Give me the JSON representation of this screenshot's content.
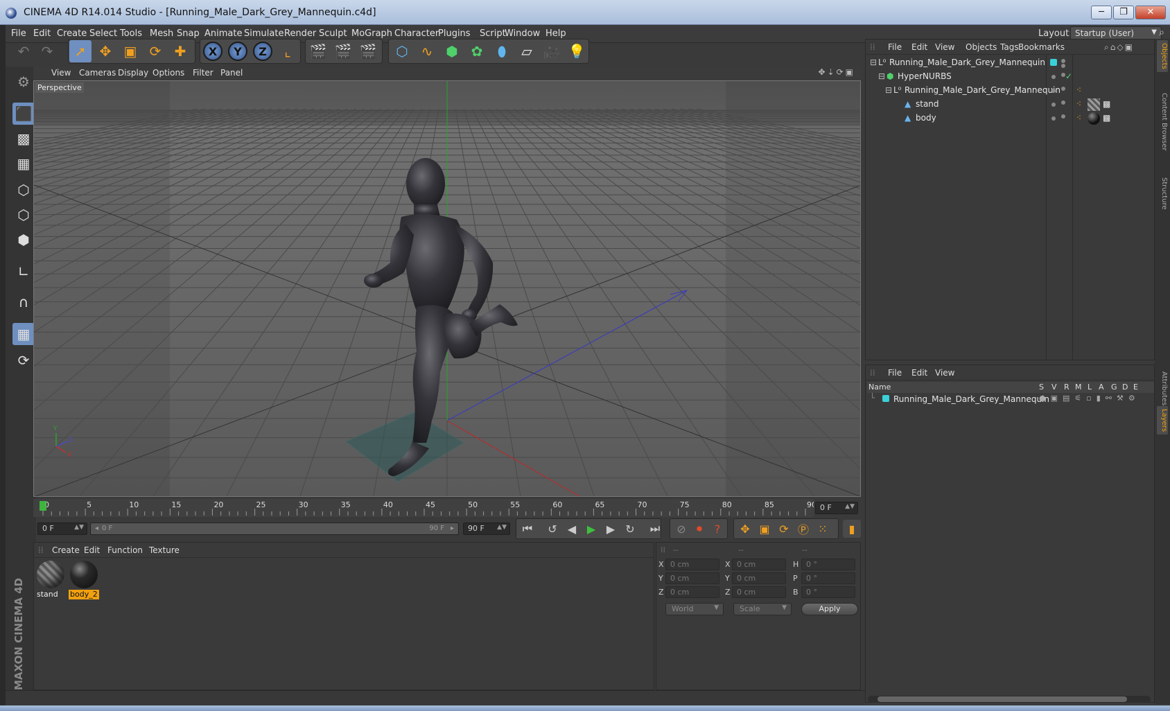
{
  "window": {
    "title": "CINEMA 4D R14.014 Studio - [Running_Male_Dark_Grey_Mannequin.c4d]",
    "min": "─",
    "max": "❐",
    "close": "✕"
  },
  "menu": {
    "items": [
      "File",
      "Edit",
      "Create",
      "Select",
      "Tools",
      "Mesh",
      "Snap",
      "Animate",
      "Simulate",
      "Render",
      "Sculpt",
      "MoGraph",
      "Character",
      "Plugins",
      "Script",
      "Window",
      "Help"
    ],
    "layout_label": "Layout:",
    "layout_value": "Startup (User)"
  },
  "viewport": {
    "menu": [
      "View",
      "Cameras",
      "Display",
      "Options",
      "Filter",
      "Panel"
    ],
    "label": "Perspective"
  },
  "timeline": {
    "ticks": [
      "0",
      "5",
      "10",
      "15",
      "20",
      "25",
      "30",
      "35",
      "40",
      "45",
      "50",
      "55",
      "60",
      "65",
      "70",
      "75",
      "80",
      "85",
      "90"
    ],
    "current_frame": "0 F",
    "start_field": "0 F",
    "range_start": "0 F",
    "range_end": "90 F",
    "end_field": "90 F"
  },
  "material_manager": {
    "menu": [
      "Create",
      "Edit",
      "Function",
      "Texture"
    ],
    "materials": [
      {
        "name": "stand",
        "selected": false
      },
      {
        "name": "body_2",
        "selected": true
      }
    ]
  },
  "coordinates": {
    "headers": [
      "--",
      "--",
      "--"
    ],
    "rows": [
      {
        "a": "X",
        "av": "0 cm",
        "b": "X",
        "bv": "0 cm",
        "c": "H",
        "cv": "0 °"
      },
      {
        "a": "Y",
        "av": "0 cm",
        "b": "Y",
        "bv": "0 cm",
        "c": "P",
        "cv": "0 °"
      },
      {
        "a": "Z",
        "av": "0 cm",
        "b": "Z",
        "bv": "0 cm",
        "c": "B",
        "cv": "0 °"
      }
    ],
    "mode": "World",
    "scale": "Scale",
    "apply": "Apply"
  },
  "object_manager": {
    "menu": [
      "File",
      "Edit",
      "View",
      "Objects",
      "Tags",
      "Bookmarks"
    ],
    "objects": [
      {
        "name": "Running_Male_Dark_Grey_Mannequin",
        "depth": 0,
        "icon": "null-icon"
      },
      {
        "name": "HyperNURBS",
        "depth": 1,
        "icon": "hypernurbs-icon"
      },
      {
        "name": "Running_Male_Dark_Grey_Mannequin",
        "depth": 2,
        "icon": "null-icon"
      },
      {
        "name": "stand",
        "depth": 3,
        "icon": "polygon-icon"
      },
      {
        "name": "body",
        "depth": 3,
        "icon": "polygon-icon"
      }
    ]
  },
  "layer_manager": {
    "menu": [
      "File",
      "Edit",
      "View"
    ],
    "columns": [
      "Name",
      "S",
      "V",
      "R",
      "M",
      "L",
      "A",
      "G",
      "D",
      "E"
    ],
    "layers": [
      {
        "name": "Running_Male_Dark_Grey_Mannequin",
        "color": "#3ad0d8"
      }
    ]
  },
  "side_tabs": [
    "Objects",
    "Content Browser",
    "Structure",
    "Attributes",
    "Layers"
  ],
  "branding": "MAXON CINEMA 4D",
  "colors": {
    "accent": "#f0a010",
    "selection": "#6e8fc0",
    "layer": "#3ad0d8"
  }
}
